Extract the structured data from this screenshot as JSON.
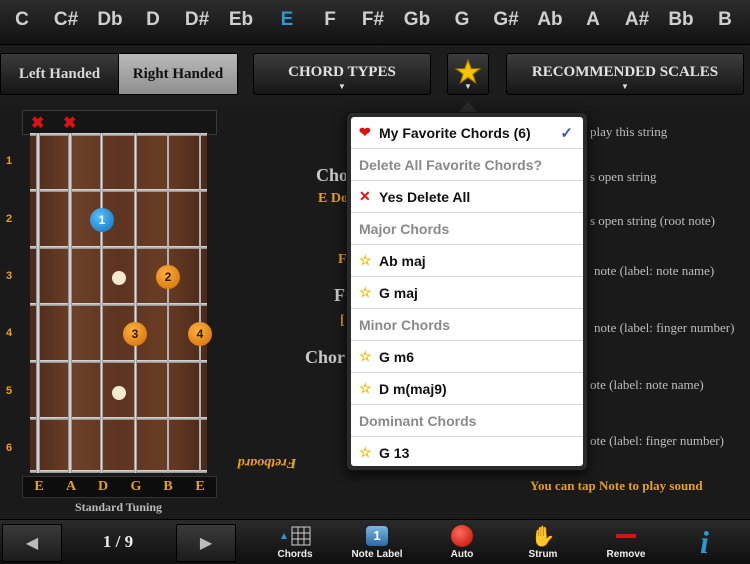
{
  "keys": [
    {
      "label": "C",
      "selected": false
    },
    {
      "label": "C#",
      "selected": false
    },
    {
      "label": "Db",
      "selected": false
    },
    {
      "label": "D",
      "selected": false
    },
    {
      "label": "D#",
      "selected": false
    },
    {
      "label": "Eb",
      "selected": false
    },
    {
      "label": "E",
      "selected": true
    },
    {
      "label": "F",
      "selected": false
    },
    {
      "label": "F#",
      "selected": false
    },
    {
      "label": "Gb",
      "selected": false
    },
    {
      "label": "G",
      "selected": false
    },
    {
      "label": "G#",
      "selected": false
    },
    {
      "label": "Ab",
      "selected": false
    },
    {
      "label": "A",
      "selected": false
    },
    {
      "label": "A#",
      "selected": false
    },
    {
      "label": "Bb",
      "selected": false
    },
    {
      "label": "B",
      "selected": false
    }
  ],
  "toolbar": {
    "left_handed": "Left Handed",
    "right_handed": "Right Handed",
    "chord_types": "CHORD TYPES",
    "recommended_scales": "RECOMMENDED SCALES"
  },
  "fretboard": {
    "fret_numbers": [
      "1",
      "2",
      "3",
      "4",
      "5",
      "6"
    ],
    "string_names": [
      "E",
      "A",
      "D",
      "G",
      "B",
      "E"
    ],
    "tuning": "Standard Tuning",
    "brand": "Fretboard",
    "brand_i": "i",
    "fingers": [
      "1",
      "2",
      "3",
      "4"
    ]
  },
  "middle_partial": {
    "line1": "Cho",
    "line2": "E Do",
    "line3": "F",
    "line4": "F",
    "line5": "[",
    "line6": "Chor"
  },
  "legend_partial": [
    "play this string",
    "s open string",
    "s open string (root note)",
    "note (label: note name)",
    "note (label: finger number)",
    "ote (label: note name)",
    "ote (label: finger number)"
  ],
  "tap_hint": "You can tap Note to play sound",
  "popover": {
    "items": [
      {
        "kind": "entry",
        "icon": "heart",
        "text": "My Favorite Chords (6)",
        "checked": true
      },
      {
        "kind": "header",
        "icon": "",
        "text": "Delete All Favorite Chords?",
        "checked": false
      },
      {
        "kind": "entry",
        "icon": "x",
        "text": "Yes Delete All",
        "checked": false
      },
      {
        "kind": "header",
        "icon": "",
        "text": "Major Chords",
        "checked": false
      },
      {
        "kind": "entry",
        "icon": "star",
        "text": "Ab maj",
        "checked": false
      },
      {
        "kind": "entry",
        "icon": "star",
        "text": "G maj",
        "checked": false
      },
      {
        "kind": "header",
        "icon": "",
        "text": "Minor Chords",
        "checked": false
      },
      {
        "kind": "entry",
        "icon": "star",
        "text": "G m6",
        "checked": false
      },
      {
        "kind": "entry",
        "icon": "star",
        "text": "D m(maj9)",
        "checked": false
      },
      {
        "kind": "header",
        "icon": "",
        "text": "Dominant Chords",
        "checked": false
      },
      {
        "kind": "entry",
        "icon": "star",
        "text": "G 13",
        "checked": false
      }
    ]
  },
  "pager": {
    "count": "1 / 9"
  },
  "bottom_tools": {
    "chords": "Chords",
    "note_label": "Note Label",
    "auto": "Auto",
    "strum": "Strum",
    "remove": "Remove",
    "note_label_badge": "1",
    "info": "i"
  },
  "colors": {
    "accent": "#2a9ad6",
    "orange": "#e8a020",
    "fav_star": "#f2c200"
  }
}
